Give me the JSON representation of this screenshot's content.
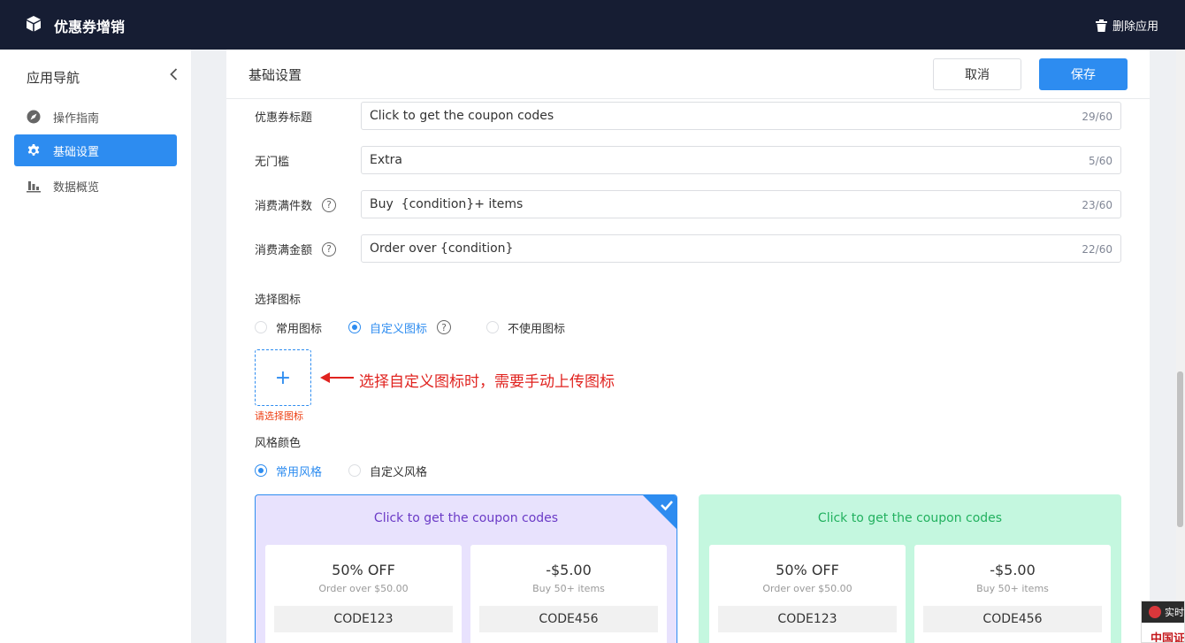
{
  "topbar": {
    "app_title": "优惠券增销",
    "delete_label": "删除应用"
  },
  "sidebar": {
    "title": "应用导航",
    "items": [
      {
        "label": "操作指南",
        "icon": "compass-icon"
      },
      {
        "label": "基础设置",
        "icon": "gear-icon",
        "active": true
      },
      {
        "label": "数据概览",
        "icon": "bar-chart-icon"
      }
    ]
  },
  "header": {
    "title": "基础设置",
    "cancel_label": "取消",
    "save_label": "保存"
  },
  "fields": [
    {
      "label": "优惠券标题",
      "value": "Click to get the coupon codes",
      "count": "29/60",
      "help": false
    },
    {
      "label": "无门槛",
      "value": "Extra",
      "count": "5/60",
      "help": false
    },
    {
      "label": "消费满件数",
      "value": "Buy  {condition}+ items",
      "count": "23/60",
      "help": true
    },
    {
      "label": "消费满金额",
      "value": "Order over {condition}",
      "count": "22/60",
      "help": true
    }
  ],
  "icon_section": {
    "label": "选择图标",
    "options": [
      "常用图标",
      "自定义图标",
      "不使用图标"
    ],
    "selected": "自定义图标",
    "upload_symbol": "+",
    "upload_error": "请选择图标",
    "annotation": "选择自定义图标时，需要手动上传图标"
  },
  "style_section": {
    "label": "风格颜色",
    "options": [
      "常用风格",
      "自定义风格"
    ],
    "selected": "常用风格"
  },
  "cards": [
    {
      "title": "Click to get the coupon codes",
      "selected": true,
      "background": "#e8e2fd",
      "title_color": "#6b3bc7",
      "coupons": [
        {
          "amount": "50% OFF",
          "condition": "Order over $50.00",
          "code": "CODE123"
        },
        {
          "amount": "-$5.00",
          "condition": "Buy 50+ items",
          "code": "CODE456"
        }
      ]
    },
    {
      "title": "Click to get the coupon codes",
      "selected": false,
      "background": "#c4f7df",
      "title_color": "#22b15f",
      "coupons": [
        {
          "amount": "50% OFF",
          "condition": "Order over $50.00",
          "code": "CODE123"
        },
        {
          "amount": "-$5.00",
          "condition": "Buy 50+ items",
          "code": "CODE456"
        }
      ]
    }
  ],
  "corner_widget": {
    "top_text": "实时",
    "bottom_text": "中国证"
  },
  "colors": {
    "primary": "#2d8cf0",
    "topbar": "#161d33",
    "error": "#ed4014",
    "annotation": "#e0231f"
  }
}
